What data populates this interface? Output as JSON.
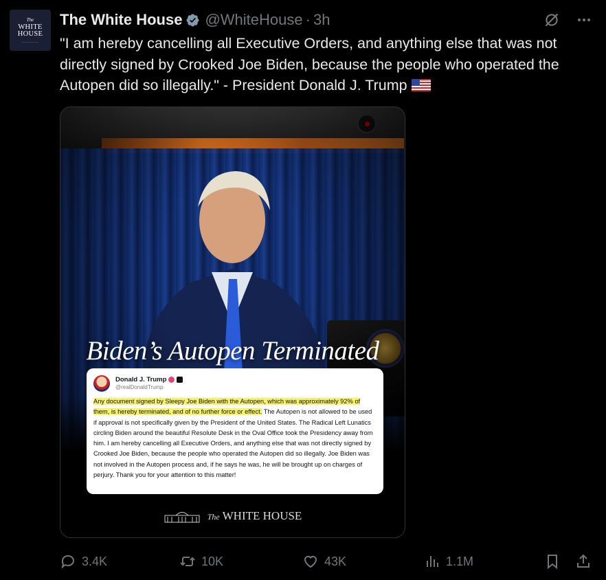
{
  "author": {
    "avatar_the": "The",
    "avatar_line1": "WHITE",
    "avatar_line2": "HOUSE",
    "display_name": "The White House",
    "handle": "@WhiteHouse",
    "separator": "·",
    "time": "3h"
  },
  "tweet": {
    "text": "\"I am hereby cancelling all Executive Orders, and anything else that was not directly signed by Crooked Joe Biden, because the people who operated the Autopen did so illegally.\" - President Donald J. Trump"
  },
  "media": {
    "overlay_title": "Biden’s Autopen Terminated",
    "quoted_post": {
      "name": "Donald J. Trump",
      "handle": "@realDonaldTrump",
      "highlighted_text": "Any document signed by Sleepy Joe Biden with the Autopen, which was approximately 92% of them, is hereby terminated, and of no further force or effect.",
      "rest_text": " The Autopen is not allowed to be used if approval is not specifically given by the President of the United States. The Radical Left Lunatics circling Biden around the beautiful Resolute Desk in the Oval Office took the Presidency away from him. I am hereby cancelling all Executive Orders, and anything else that was not directly signed by Crooked Joe Biden, because the people who operated the Autopen did so illegally. Joe Biden was not involved in the Autopen process and, if he says he was, he will be brought up on charges of perjury. Thank you for your attention to this matter!"
    },
    "brand_small": "The",
    "brand_text": "WHITE HOUSE"
  },
  "actions": {
    "replies": "3.4K",
    "reposts": "10K",
    "likes": "43K",
    "views": "1.1M"
  },
  "colors": {
    "background": "#000000",
    "text": "#e7e9ea",
    "muted": "#71767b",
    "verified": "#829aab",
    "highlight": "#f6f36a"
  }
}
